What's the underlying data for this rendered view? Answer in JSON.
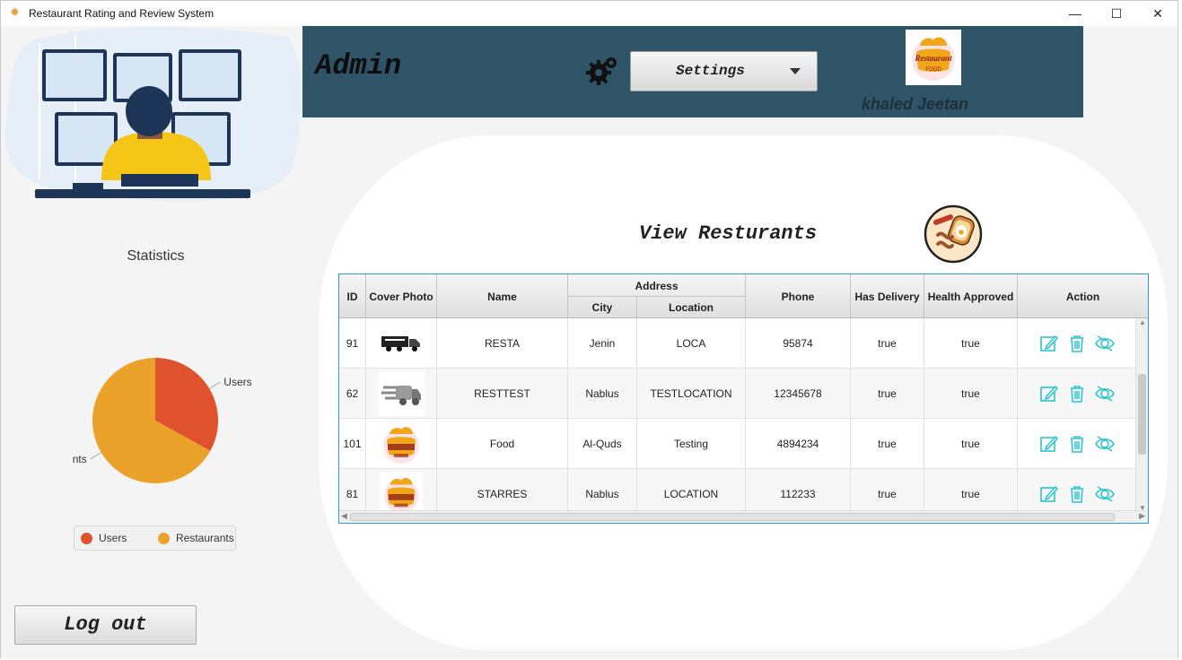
{
  "window": {
    "title": "Restaurant Rating and Review System",
    "minimize": "—",
    "maximize": "☐",
    "close": "✕"
  },
  "sidebar": {
    "stats_title": "Statistics",
    "chart_data": {
      "type": "pie",
      "title": "",
      "slices": [
        {
          "label": "Users",
          "value": 33,
          "color": "#e0522d"
        },
        {
          "label": "Restaurants",
          "value": 67,
          "color": "#eba22a"
        }
      ],
      "legend": [
        "Users",
        "Restaurants"
      ],
      "legend_position": "bottom"
    },
    "logout_label": "Log out"
  },
  "header": {
    "role": "Admin",
    "settings_label": "Settings",
    "user_name": "khaled Jeetan",
    "logo_top": "Restaurant",
    "logo_bottom": "FOOD",
    "color": "#2f5468"
  },
  "main": {
    "title": "View Resturants",
    "table": {
      "columns": [
        "ID",
        "Cover Photo",
        "Name",
        "Address",
        "City",
        "Location",
        "Phone",
        "Has Delivery",
        "Health Approved",
        "Action"
      ],
      "rows": [
        {
          "id": "91",
          "cover": "truck-icon",
          "name": "RESTA",
          "city": "Jenin",
          "location": "LOCA",
          "phone": "95874",
          "delivery": "true",
          "health": "true"
        },
        {
          "id": "62",
          "cover": "fast-truck-icon",
          "name": "RESTTEST",
          "city": "Nablus",
          "location": "TESTLOCATION",
          "phone": "12345678",
          "delivery": "true",
          "health": "true"
        },
        {
          "id": "101",
          "cover": "restaurant-logo",
          "name": "Food",
          "city": "Al-Quds",
          "location": "Testing",
          "phone": "4894234",
          "delivery": "true",
          "health": "true"
        },
        {
          "id": "81",
          "cover": "restaurant-logo",
          "name": "STARRES",
          "city": "Nablus",
          "location": "LOCATION",
          "phone": "112233",
          "delivery": "true",
          "health": "true"
        }
      ]
    },
    "action_color": "#2cc5d2"
  }
}
